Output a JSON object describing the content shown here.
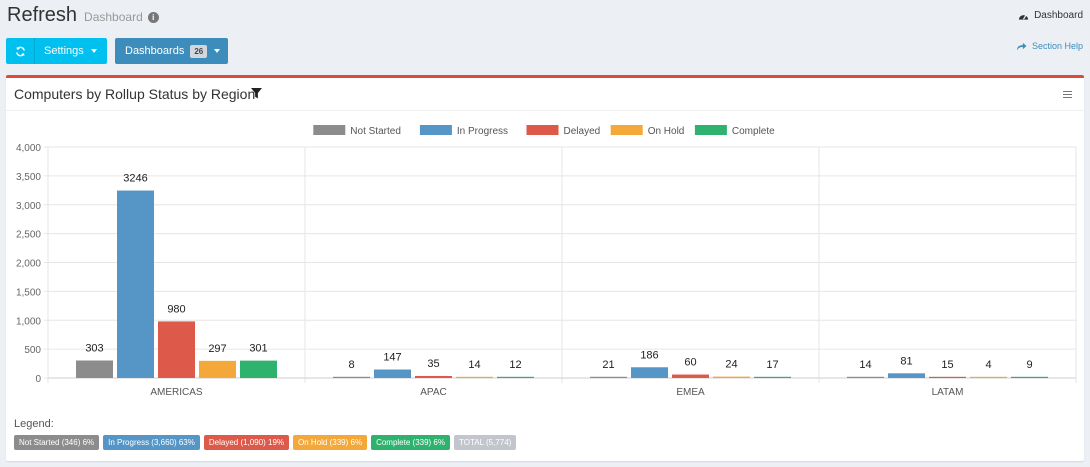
{
  "header": {
    "title": "Refresh",
    "subtitle": "Dashboard"
  },
  "breadcrumb": {
    "label": "Dashboard"
  },
  "toolbar": {
    "settings_label": "Settings",
    "dashboards_label": "Dashboards",
    "dashboards_count": "26",
    "help_label": "Section Help"
  },
  "panel": {
    "title": "Computers by Rollup Status by Region"
  },
  "colors": {
    "not_started": "#8c8c8c",
    "in_progress": "#5596c6",
    "delayed": "#dd5a4a",
    "on_hold": "#f4a83a",
    "complete": "#2eb26e",
    "total": "#c2c5cb"
  },
  "chart_data": {
    "type": "bar",
    "categories": [
      "AMERICAS",
      "APAC",
      "EMEA",
      "LATAM"
    ],
    "series": [
      {
        "name": "Not Started",
        "color": "#8c8c8c",
        "values": [
          303,
          8,
          21,
          14
        ]
      },
      {
        "name": "In Progress",
        "color": "#5596c6",
        "values": [
          3246,
          147,
          186,
          81
        ]
      },
      {
        "name": "Delayed",
        "color": "#dd5a4a",
        "values": [
          980,
          35,
          60,
          15
        ]
      },
      {
        "name": "On Hold",
        "color": "#f4a83a",
        "values": [
          297,
          14,
          24,
          4
        ]
      },
      {
        "name": "Complete",
        "color": "#2eb26e",
        "values": [
          301,
          12,
          17,
          9
        ]
      }
    ],
    "ylim": [
      0,
      4000
    ],
    "yticks": [
      "0",
      "500",
      "1,000",
      "1,500",
      "2,000",
      "2,500",
      "3,000",
      "3,500",
      "4,000"
    ],
    "legend_position": "top-center",
    "grid": true
  },
  "summary_legend": {
    "title": "Legend:",
    "items": [
      {
        "label": "Not Started (346) 6%",
        "color": "#8c8c8c"
      },
      {
        "label": "In Progress (3,660) 63%",
        "color": "#5596c6"
      },
      {
        "label": "Delayed (1,090) 19%",
        "color": "#dd5a4a"
      },
      {
        "label": "On Hold (339) 6%",
        "color": "#f4a83a"
      },
      {
        "label": "Complete (339) 6%",
        "color": "#2eb26e"
      },
      {
        "label": "TOTAL (5,774)",
        "color": "#c2c5cb"
      }
    ]
  }
}
